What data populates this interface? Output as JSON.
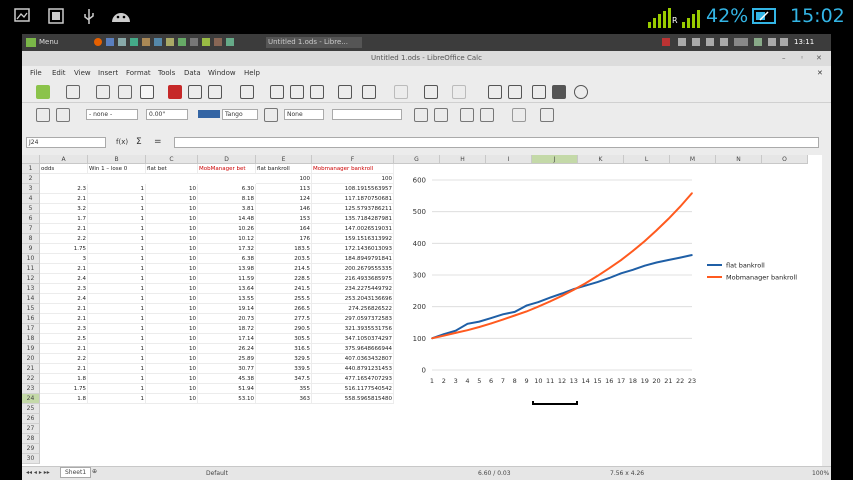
{
  "android": {
    "battery_pct": "42%",
    "time": "15:02",
    "net_label": "R"
  },
  "panel": {
    "menu": "Menu",
    "task": "Untitled 1.ods - Libre...",
    "clock": "13:11"
  },
  "window": {
    "title": "Untitled 1.ods - LibreOffice Calc"
  },
  "menus": [
    "File",
    "Edit",
    "View",
    "Insert",
    "Format",
    "Tools",
    "Data",
    "Window",
    "Help"
  ],
  "format": {
    "line_style": "- none -",
    "line_width": "0.00\"",
    "color_name": "Tango",
    "area_style": "None"
  },
  "formula": {
    "name_box": "J24",
    "fx": "f(x)",
    "sum": "Σ",
    "eq": "="
  },
  "columns": [
    "A",
    "B",
    "C",
    "D",
    "E",
    "F",
    "G",
    "H",
    "I",
    "J",
    "K",
    "L",
    "M",
    "N",
    "O"
  ],
  "rows": [
    "1",
    "2",
    "3",
    "4",
    "5",
    "6",
    "7",
    "8",
    "9",
    "10",
    "11",
    "12",
    "13",
    "14",
    "15",
    "16",
    "17",
    "18",
    "19",
    "20",
    "21",
    "22",
    "23",
    "24",
    "25",
    "26",
    "27",
    "28",
    "29",
    "30"
  ],
  "headers": {
    "a": "odds",
    "b": "Win 1 – lose 0",
    "c": "flat bet",
    "d": "MobManager bet",
    "e": "flat bankroll",
    "f": "Mobmanager bankroll"
  },
  "row2": {
    "e": "100",
    "f": "100"
  },
  "table": [
    [
      "2.3",
      "1",
      "10",
      "6.30",
      "113",
      "108.1915563957"
    ],
    [
      "2.1",
      "1",
      "10",
      "8.18",
      "124",
      "117.1870750681"
    ],
    [
      "3.2",
      "1",
      "10",
      "3.81",
      "146",
      "125.5793786211"
    ],
    [
      "1.7",
      "1",
      "10",
      "14.48",
      "153",
      "135.7184287981"
    ],
    [
      "2.1",
      "1",
      "10",
      "10.26",
      "164",
      "147.0026519031"
    ],
    [
      "2.2",
      "1",
      "10",
      "10.12",
      "176",
      "159.1516313992"
    ],
    [
      "1.75",
      "1",
      "10",
      "17.32",
      "183.5",
      "172.1436013093"
    ],
    [
      "3",
      "1",
      "10",
      "6.38",
      "203.5",
      "184.8949791841"
    ],
    [
      "2.1",
      "1",
      "10",
      "13.98",
      "214.5",
      "200.2679555335"
    ],
    [
      "2.4",
      "1",
      "10",
      "11.59",
      "228.5",
      "216.4933685975"
    ],
    [
      "2.3",
      "1",
      "10",
      "13.64",
      "241.5",
      "234.2275449792"
    ],
    [
      "2.4",
      "1",
      "10",
      "13.55",
      "255.5",
      "253.2043136696"
    ],
    [
      "2.1",
      "1",
      "10",
      "19.14",
      "266.5",
      "274.256826522"
    ],
    [
      "2.1",
      "1",
      "10",
      "20.73",
      "277.5",
      "297.0597372583"
    ],
    [
      "2.3",
      "1",
      "10",
      "18.72",
      "290.5",
      "321.3935531756"
    ],
    [
      "2.5",
      "1",
      "10",
      "17.14",
      "305.5",
      "347.1050374297"
    ],
    [
      "2.1",
      "1",
      "10",
      "26.24",
      "316.5",
      "375.9648666944"
    ],
    [
      "2.2",
      "1",
      "10",
      "25.89",
      "329.5",
      "407.0363432807"
    ],
    [
      "2.1",
      "1",
      "10",
      "30.77",
      "339.5",
      "440.8791231453"
    ],
    [
      "1.8",
      "1",
      "10",
      "45.38",
      "347.5",
      "477.1654707293"
    ],
    [
      "1.75",
      "1",
      "10",
      "51.94",
      "355",
      "516.1177540542"
    ],
    [
      "1.8",
      "1",
      "10",
      "53.10",
      "363",
      "558.5965815480"
    ]
  ],
  "chart_data": {
    "type": "line",
    "x": [
      1,
      2,
      3,
      4,
      5,
      6,
      7,
      8,
      9,
      10,
      11,
      12,
      13,
      14,
      15,
      16,
      17,
      18,
      19,
      20,
      21,
      22,
      23
    ],
    "series": [
      {
        "name": "flat bankroll",
        "color": "#1f5fa6",
        "values": [
          100,
          113,
          124,
          146,
          153,
          164,
          176,
          183.5,
          203.5,
          214.5,
          228.5,
          241.5,
          255.5,
          266.5,
          277.5,
          290.5,
          305.5,
          316.5,
          329.5,
          339.5,
          347.5,
          355,
          363
        ]
      },
      {
        "name": "Mobmanager bankroll",
        "color": "#ff5a1f",
        "values": [
          100,
          108.19,
          117.19,
          125.58,
          135.72,
          147.0,
          159.15,
          172.14,
          184.89,
          200.27,
          216.49,
          234.23,
          253.2,
          274.26,
          297.06,
          321.39,
          347.11,
          375.96,
          407.04,
          440.88,
          477.17,
          516.12,
          558.6
        ]
      }
    ],
    "yticks": [
      "0",
      "100",
      "200",
      "300",
      "400",
      "500",
      "600"
    ],
    "ylim": [
      0,
      600
    ],
    "grid": true,
    "legend": "right"
  },
  "sheet": {
    "tab": "Sheet1",
    "style": "Default",
    "pos": "6.60 / 0.03",
    "size": "7.56 x 4.26",
    "zoom": "100%"
  }
}
